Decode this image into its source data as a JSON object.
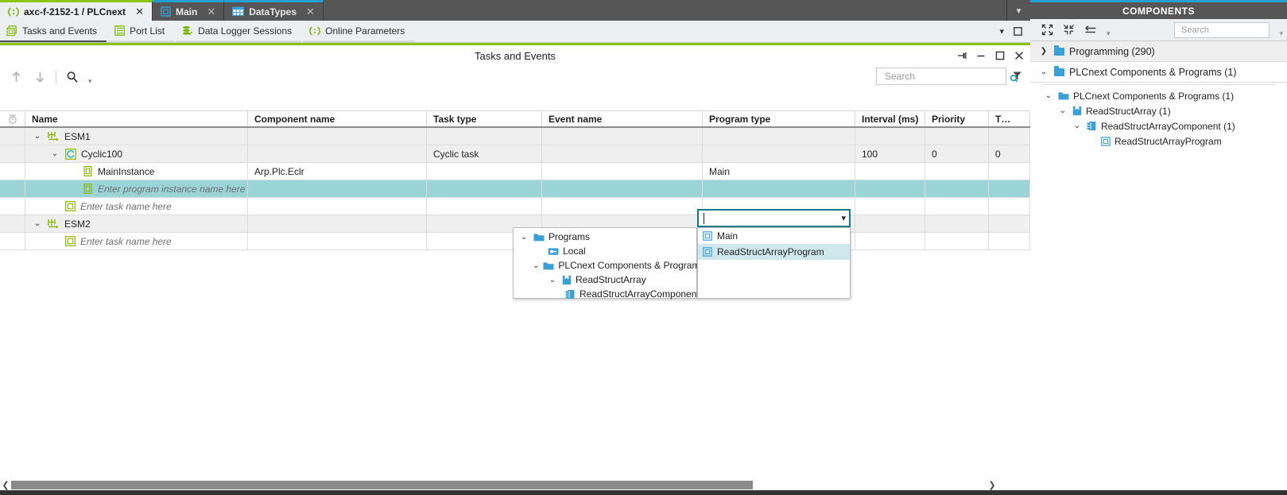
{
  "window": {
    "tabs": [
      {
        "label": "axc-f-2152-1 / PLCnext",
        "icon": "plcnext-icon",
        "close": "✕",
        "active": true
      },
      {
        "label": "Main",
        "icon": "program-icon",
        "close": "✕",
        "active": false
      },
      {
        "label": "DataTypes",
        "icon": "datatypes-icon",
        "close": "✕",
        "active": false
      }
    ],
    "tabbar_overflow_icon": "chevron-down-icon"
  },
  "subtabs": [
    {
      "label": "Tasks and Events",
      "icon": "tasks-events-icon",
      "active": true
    },
    {
      "label": "Port List",
      "icon": "port-list-icon",
      "active": false
    },
    {
      "label": "Data Logger Sessions",
      "icon": "data-logger-icon",
      "active": false
    },
    {
      "label": "Online Parameters",
      "icon": "online-parameters-icon",
      "active": false
    }
  ],
  "subbar_right": {
    "chevron": "chevron-down-icon",
    "restore": "restore-icon"
  },
  "view": {
    "title": "Tasks and Events",
    "buttons": [
      {
        "name": "pin-icon",
        "glyph": "⇥"
      },
      {
        "name": "minimize-icon",
        "glyph": "–"
      },
      {
        "name": "maximize-icon",
        "glyph": "□"
      },
      {
        "name": "close-icon",
        "glyph": "✕"
      }
    ]
  },
  "grid_toolbar": {
    "move_up_icon": "arrow-up-icon",
    "move_down_icon": "arrow-down-icon",
    "find_icon": "search-icon",
    "dropdown_icon": "chevron-down-icon"
  },
  "search": {
    "value": "",
    "placeholder": "Search",
    "icon": "search-filter-icon"
  },
  "grid": {
    "columns": [
      {
        "key": "gutter",
        "label": "",
        "icon": "watch-column-icon"
      },
      {
        "key": "name",
        "label": "Name"
      },
      {
        "key": "component",
        "label": "Component name"
      },
      {
        "key": "tasktype",
        "label": "Task type"
      },
      {
        "key": "event",
        "label": "Event name"
      },
      {
        "key": "ptype",
        "label": "Program type"
      },
      {
        "key": "interval",
        "label": "Interval (ms)"
      },
      {
        "key": "priority",
        "label": "Priority"
      },
      {
        "key": "trunc",
        "label": "T…"
      }
    ],
    "rows": [
      {
        "style": "rowgrey",
        "indent": 0,
        "chevron": "⌄",
        "icon": "esm-icon",
        "name": "ESM1",
        "component": "",
        "tasktype": "",
        "event": "",
        "ptype": "",
        "interval": "",
        "priority": "",
        "trunc": ""
      },
      {
        "style": "rowgrey",
        "indent": 1,
        "chevron": "⌄",
        "icon": "cyclic-task-icon",
        "name": "Cyclic100",
        "component": "",
        "tasktype": "Cyclic task",
        "event": "",
        "ptype": "",
        "interval": "100",
        "priority": "0",
        "trunc": "0"
      },
      {
        "style": "rowwhite",
        "indent": 2,
        "chevron": "",
        "icon": "program-instance-icon",
        "name": "MainInstance",
        "component": "Arp.Plc.Eclr",
        "tasktype": "",
        "event": "",
        "ptype": "Main",
        "interval": "",
        "priority": "",
        "trunc": ""
      },
      {
        "style": "rowsel",
        "indent": 2,
        "chevron": "",
        "icon": "program-instance-icon",
        "name": "Enter program instance name here",
        "placeholder": true,
        "component": "",
        "tasktype": "",
        "event": "",
        "ptype": "",
        "interval": "",
        "priority": "",
        "trunc": ""
      },
      {
        "style": "rowwhite",
        "indent": 1,
        "chevron": "",
        "icon": "task-icon",
        "name": "Enter task name here",
        "placeholder": true,
        "component": "",
        "tasktype": "",
        "event": "",
        "ptype": "",
        "interval": "",
        "priority": "",
        "trunc": ""
      },
      {
        "style": "rowgrey",
        "indent": 0,
        "chevron": "⌄",
        "icon": "esm-icon",
        "name": "ESM2",
        "component": "",
        "tasktype": "",
        "event": "",
        "ptype": "",
        "interval": "",
        "priority": "",
        "trunc": ""
      },
      {
        "style": "rowwhite",
        "indent": 1,
        "chevron": "",
        "icon": "task-icon",
        "name": "Enter task name here",
        "placeholder": true,
        "component": "",
        "tasktype": "",
        "event": "",
        "ptype": "",
        "interval": "",
        "priority": "",
        "trunc": ""
      }
    ]
  },
  "combo": {
    "value": "",
    "caret_icon": "chevron-down-icon",
    "options": [
      {
        "label": "Main",
        "icon": "program-icon",
        "selected": false
      },
      {
        "label": "ReadStructArrayProgram",
        "icon": "program-icon",
        "selected": true
      }
    ]
  },
  "tree_popup": {
    "rows": [
      {
        "indent": 0,
        "chevron": "⌄",
        "icon": "folder-icon",
        "label": "Programs"
      },
      {
        "indent": 1,
        "chevron": "",
        "icon": "local-icon",
        "label": "Local"
      },
      {
        "indent": 1,
        "chevron": "⌄",
        "icon": "folder-icon",
        "label": "PLCnext Components & Programs"
      },
      {
        "indent": 2,
        "chevron": "⌄",
        "icon": "library-icon",
        "label": "ReadStructArray"
      },
      {
        "indent": 3,
        "chevron": "",
        "icon": "component-icon",
        "label": "ReadStructArrayComponent"
      }
    ]
  },
  "scrollbar": {
    "left_arrow": "❮",
    "right_arrow": "❯",
    "thumb_pct": "76%"
  },
  "components_panel": {
    "title": "COMPONENTS",
    "toolbar": {
      "expand_all_icon": "expand-all-icon",
      "collapse_all_icon": "collapse-all-icon",
      "sync_icon": "sync-icon",
      "dropdown_icon": "chevron-down-icon",
      "overflow_icon": "chevron-down-icon"
    },
    "search": {
      "value": "",
      "placeholder": "Search",
      "icon": "search-filter-icon"
    },
    "nodes": [
      {
        "chevron": "❯",
        "icon": "folder-icon",
        "label": "Programming (290)",
        "style": "grey"
      },
      {
        "chevron": "⌄",
        "icon": "folder-icon",
        "label": "PLCnext Components & Programs (1)",
        "style": "white"
      }
    ],
    "tree": [
      {
        "indent": 0,
        "chevron": "⌄",
        "icon": "folder-icon",
        "label": "PLCnext Components & Programs (1)"
      },
      {
        "indent": 1,
        "chevron": "⌄",
        "icon": "library-icon",
        "label": "ReadStructArray (1)"
      },
      {
        "indent": 2,
        "chevron": "⌄",
        "icon": "component-icon",
        "label": "ReadStructArrayComponent (1)"
      },
      {
        "indent": 3,
        "chevron": "",
        "icon": "program-icon",
        "label": "ReadStructArrayProgram"
      }
    ]
  },
  "colors": {
    "accent_green": "#8bc400",
    "accent_blue": "#1f9fd4",
    "selection_teal": "#9bd4d7",
    "chrome_dark": "#565656",
    "combo_border": "#0e7a86"
  }
}
